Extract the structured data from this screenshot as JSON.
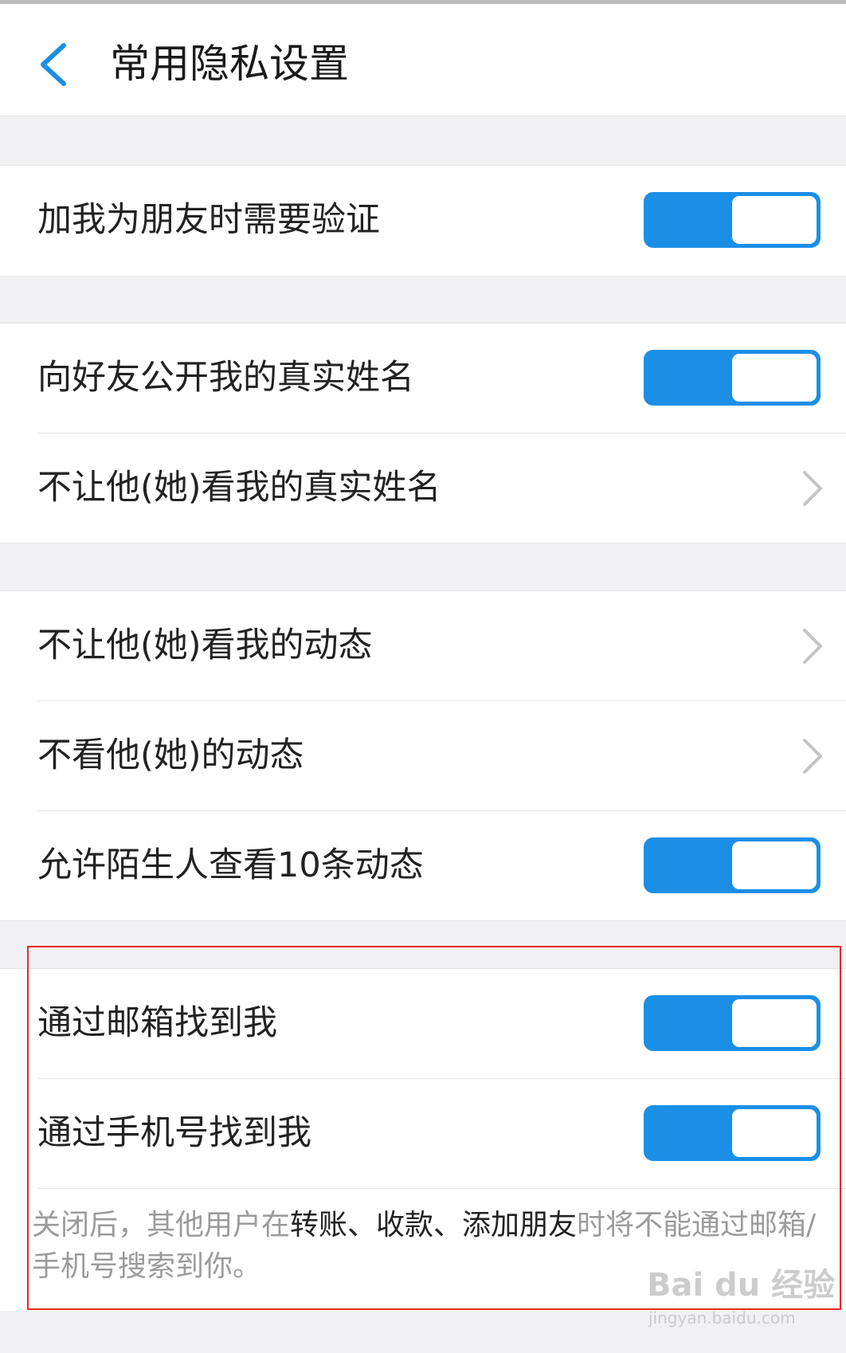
{
  "header": {
    "title": "常用隐私设置",
    "back_icon": "chevron-left-icon"
  },
  "colors": {
    "accent": "#1b8fe6",
    "annotation": "#e62a2a",
    "background": "#f1f1f3"
  },
  "settings": {
    "friend_verify": {
      "label": "加我为朋友时需要验证",
      "state": "on"
    },
    "show_real_name": {
      "label": "向好友公开我的真实姓名",
      "state": "on"
    },
    "hide_real_name_from": {
      "label": "不让他(她)看我的真实姓名"
    },
    "hide_moments_from": {
      "label": "不让他(她)看我的动态"
    },
    "not_see_moments": {
      "label": "不看他(她)的动态"
    },
    "stranger_10_posts": {
      "label": "允许陌生人查看10条动态",
      "state": "on"
    },
    "find_by_email": {
      "label": "通过邮箱找到我",
      "state": "on"
    },
    "find_by_phone": {
      "label": "通过手机号找到我",
      "state": "on"
    }
  },
  "note": {
    "prefix": "关闭后，其他用户在",
    "highlight": "转账、收款、添加朋友",
    "suffix": "时将不能通过邮箱/手机号搜索到你。"
  },
  "watermark": {
    "main": "Bai du 经验",
    "sub": "jingyan.baidu.com"
  }
}
